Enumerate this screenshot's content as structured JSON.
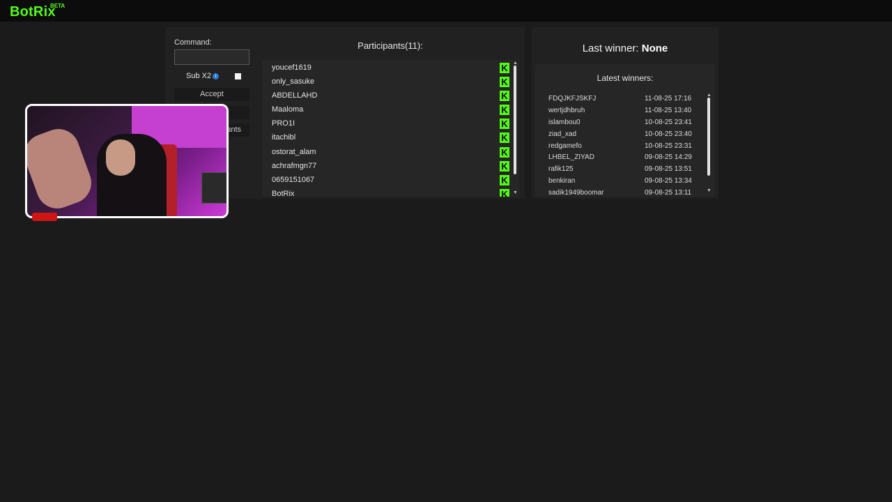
{
  "app": {
    "name": "BotRix",
    "badge": "BETA"
  },
  "giveaway": {
    "command_label": "Command:",
    "command_value": "",
    "sub_label": "Sub X2",
    "accept_label": "Accept",
    "partial_button_label": "ants"
  },
  "participants": {
    "title": "Participants(11):",
    "items": [
      "youcef1619",
      "only_sasuke",
      "ABDELLAHD",
      "Maaloma",
      "PRO1I",
      "itachibl",
      "ostorat_alam",
      "achrafmgn77",
      "0659151067",
      "BotRix"
    ]
  },
  "winners": {
    "last_winner_label": "Last winner:",
    "last_winner_value": "None",
    "latest_title": "Latest winners:",
    "items": [
      {
        "name": "FDQJKFJSKFJ",
        "date": "11-08-25 17:16"
      },
      {
        "name": "wertjdhbruh",
        "date": "11-08-25 13:40"
      },
      {
        "name": "islambou0",
        "date": "10-08-25 23:41"
      },
      {
        "name": "ziad_xad",
        "date": "10-08-25 23:40"
      },
      {
        "name": "redgamefo",
        "date": "10-08-25 23:31"
      },
      {
        "name": "LHBEL_ZIYAD",
        "date": "09-08-25 14:29"
      },
      {
        "name": "rafik125",
        "date": "09-08-25 13:51"
      },
      {
        "name": "benkiran",
        "date": "09-08-25 13:34"
      },
      {
        "name": "sadik1949boomar",
        "date": "09-08-25 13:11"
      }
    ]
  },
  "icons": {
    "platform": "kick-icon",
    "info": "info-icon"
  },
  "colors": {
    "accent": "#53fc18",
    "background": "#1b1b1b",
    "panel": "#212121"
  }
}
